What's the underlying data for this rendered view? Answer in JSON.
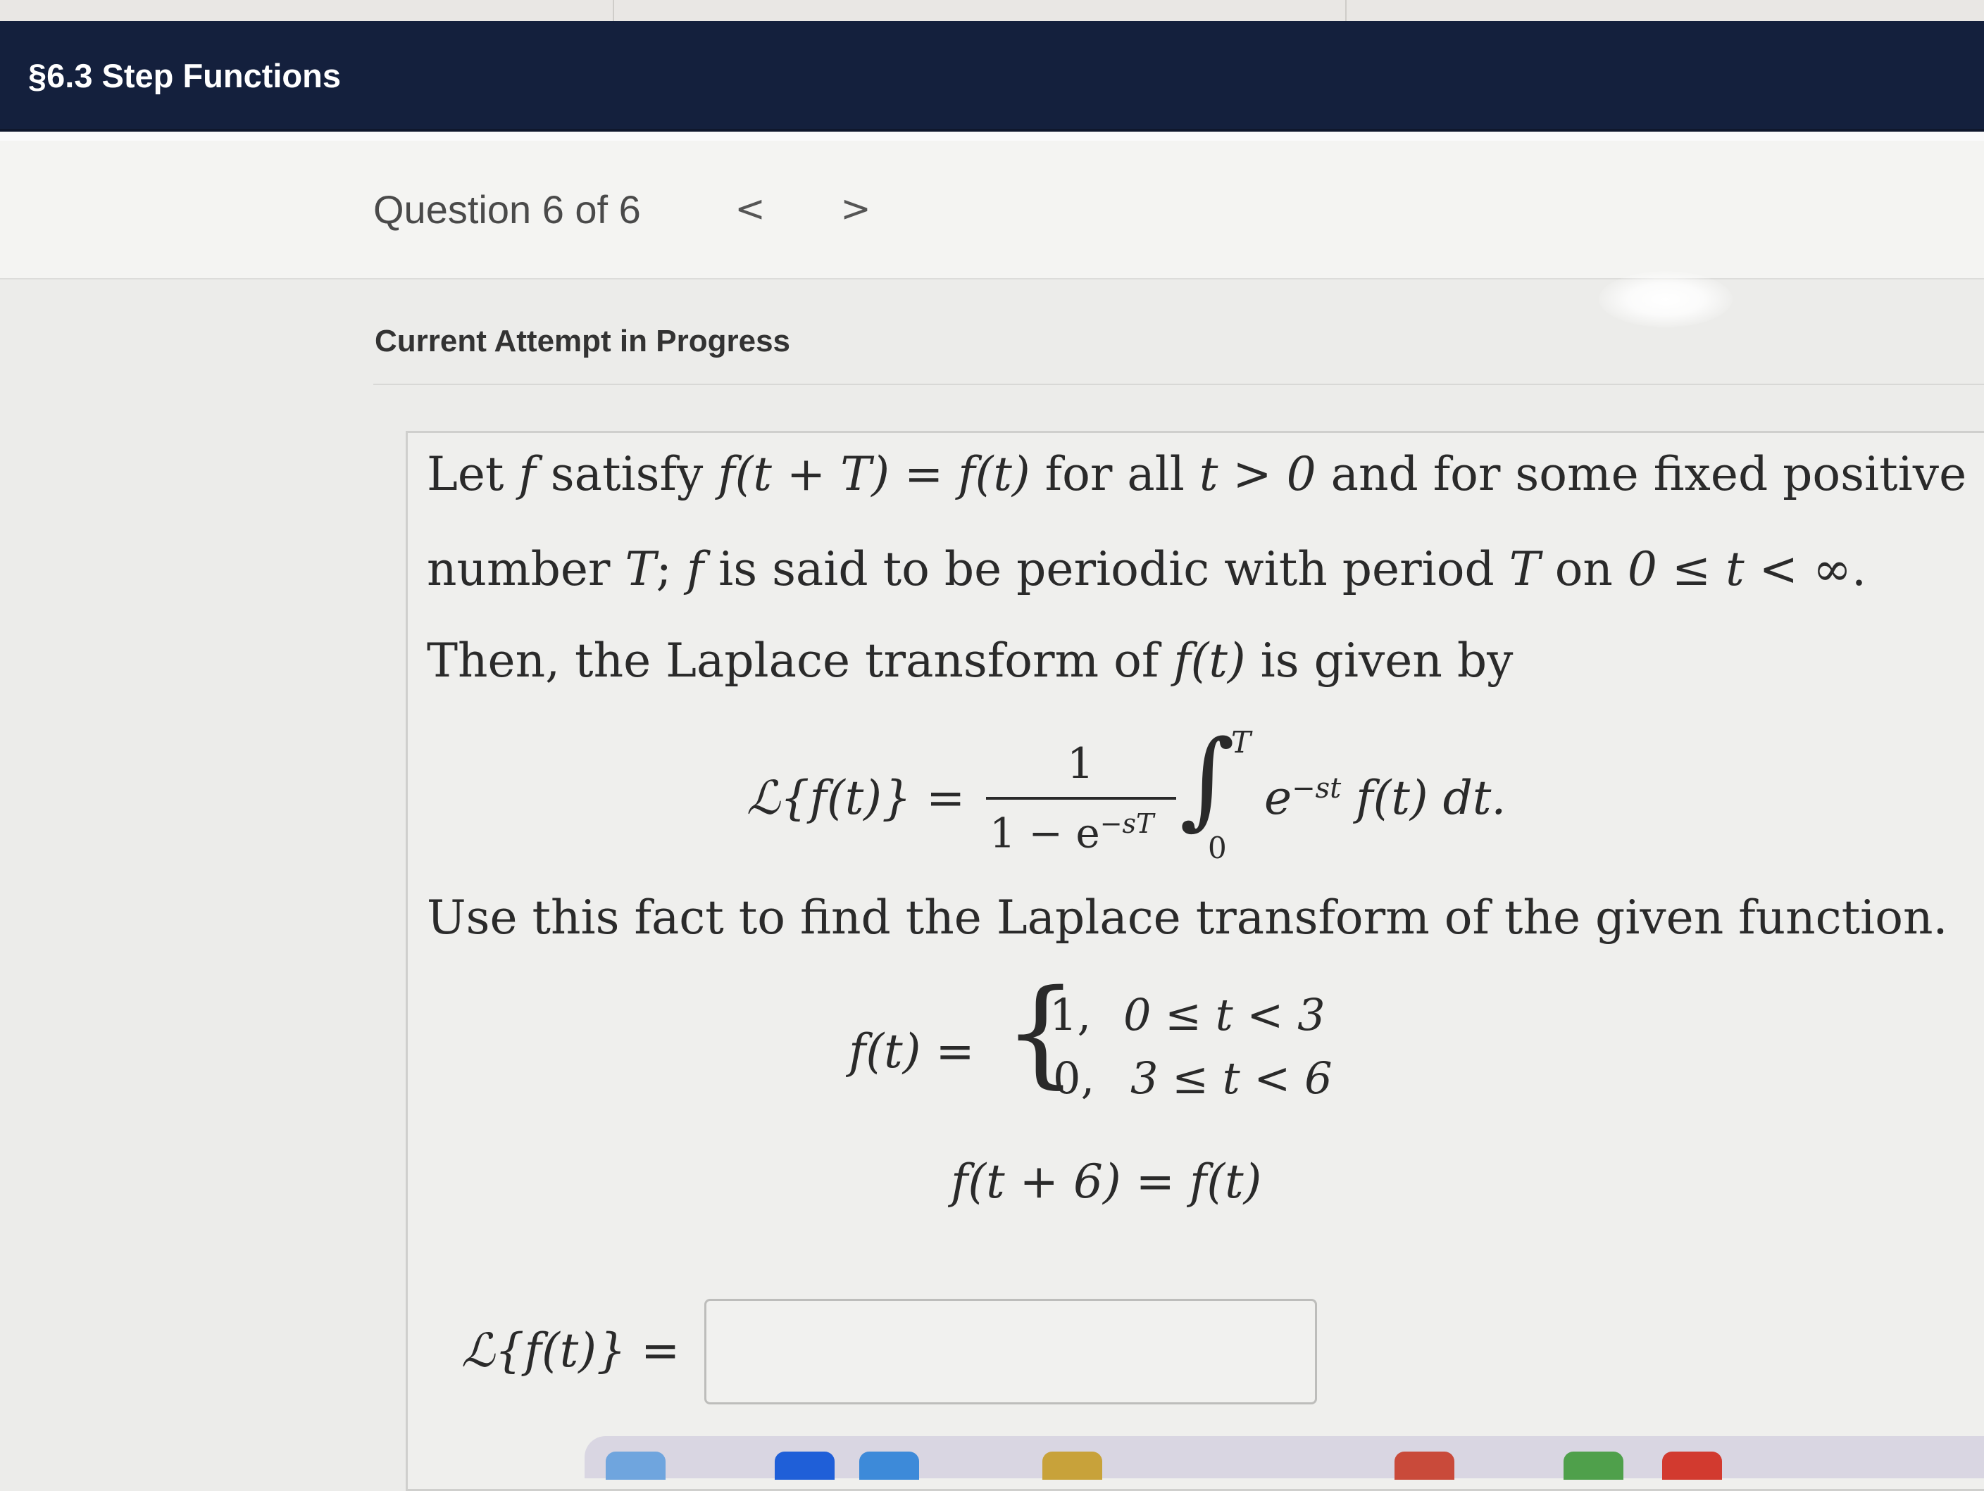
{
  "header": {
    "title": "§6.3 Step Functions"
  },
  "question_nav": {
    "counter": "Question 6 of 6",
    "prev_label": "<",
    "next_label": ">"
  },
  "attempt": {
    "label": "Current Attempt in Progress"
  },
  "problem": {
    "line1": {
      "a": "Let ",
      "f1": "f",
      "b": " satisfy ",
      "eq": "f(t + T) = f(t)",
      "c": " for all ",
      "t": "t > 0",
      "d": " and for some fixed positive"
    },
    "line2": {
      "a": "number ",
      "T": "T",
      "b": "; ",
      "f": "f",
      "c": " is said to be periodic with period ",
      "T2": "T",
      "d": " on ",
      "range": "0 ≤ t < ∞",
      "e": "."
    },
    "line3": {
      "a": "Then, the Laplace transform of ",
      "ft": "f(t)",
      "b": " is given by"
    },
    "formula": {
      "lhs": "ℒ{f(t)} =",
      "numerator": "1",
      "denominator": "1 − e",
      "den_exp": "−sT",
      "integral_sign": "∫",
      "upper": "T",
      "lower": "0",
      "integrand_e": "e",
      "integrand_exp": "−st",
      "integrand_rest": "f(t) dt."
    },
    "line4": "Use this fact to find the Laplace transform of the given function.",
    "piecewise": {
      "lhs": "f(t) =",
      "brace": "{",
      "case1_value": "1,",
      "case1_cond": "0 ≤ t < 3",
      "case2_value": "0,",
      "case2_cond": "3 ≤ t < 6"
    },
    "periodicity": "f(t + 6) = f(t)"
  },
  "answer": {
    "label": "ℒ{f(t)} =",
    "value": "",
    "placeholder": ""
  }
}
